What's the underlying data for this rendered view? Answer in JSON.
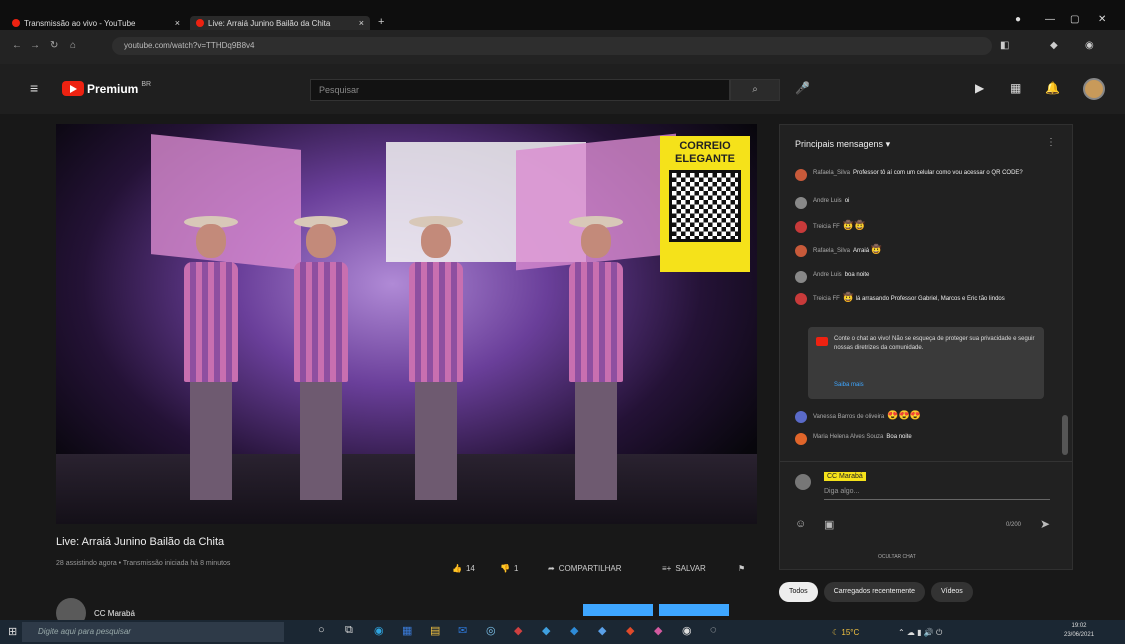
{
  "browser": {
    "tabs": [
      {
        "label": "Transmissão ao vivo - YouTube"
      },
      {
        "label": "Live: Arraiá Junino Bailão da Chita"
      }
    ],
    "address": "youtube.com/watch?v=TTHDq9B8v4"
  },
  "youtube": {
    "logo_text": "Premium",
    "search_placeholder": "Pesquisar"
  },
  "video": {
    "qr_text_line1": "CORREIO",
    "qr_text_line2": "ELEGANTE",
    "title": "Live: Arraiá Junino Bailão da Chita",
    "meta": "28 assistindo agora • Transmissão iniciada há 8 minutos",
    "likes": "14",
    "dislikes": "1",
    "share_label": "COMPARTILHAR",
    "save_label": "SALVAR",
    "channel_name": "CC Marabá"
  },
  "chat": {
    "header": "Principais mensagens",
    "messages": [
      {
        "author": "Rafaela_Silva",
        "text": "Professor tô aí com um celular como vou acessar o QR CODE?",
        "emoji": "",
        "color": "#c85a3a"
      },
      {
        "author": "Andre Luis",
        "text": "oi",
        "emoji": "",
        "color": "#888888"
      },
      {
        "author": "Treicia FF",
        "text": "",
        "emoji": "🤠🤠",
        "color": "#c83a3a"
      },
      {
        "author": "Rafaela_Silva",
        "text": "Arraiá",
        "emoji": "🤠",
        "color": "#c85a3a"
      },
      {
        "author": "Andre Luis",
        "text": "boa noite",
        "emoji": "",
        "color": "#888888"
      },
      {
        "author": "Treicia FF",
        "text": "lá arrasando Professor Gabriel, Marcos e Eric tão lindos",
        "emoji": "🤠",
        "color": "#c83a3a"
      },
      {
        "author": "Vanessa Barros de oliveira",
        "text": "",
        "emoji": "😍😍😍",
        "color": "#5a6ac8"
      },
      {
        "author": "Maria Helena Alves Souza",
        "text": "Boa noite",
        "emoji": "",
        "color": "#e0652a"
      }
    ],
    "notice_text": "Conte o chat ao vivo! Não se esqueça de proteger sua privacidade e seguir nossas diretrizes da comunidade.",
    "notice_link": "Saiba mais",
    "user_name": "CC Marabá",
    "input_placeholder": "Diga algo...",
    "char_count": "0/200",
    "hide_chat": "OCULTAR CHAT",
    "chips": [
      "Todos",
      "Carregados recentemente",
      "Vídeos"
    ]
  },
  "taskbar": {
    "search_placeholder": "Digite aqui para pesquisar",
    "temp": "15°C",
    "time": "19:02",
    "date": "23/06/2021"
  }
}
